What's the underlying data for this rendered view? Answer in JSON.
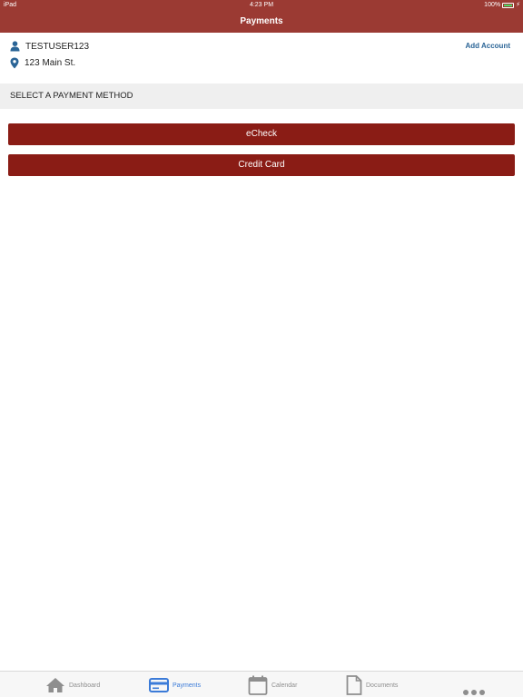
{
  "status_bar": {
    "device": "iPad",
    "time": "4:23 PM",
    "battery": "100%",
    "battery_level": 1.0
  },
  "nav": {
    "title": "Payments"
  },
  "account": {
    "username": "TESTUSER123",
    "address": "123 Main St.",
    "add_account_label": "Add Account",
    "user_icon": "person-icon",
    "address_icon": "location-pin-icon"
  },
  "section": {
    "title": "SELECT A PAYMENT METHOD"
  },
  "payment_methods": [
    {
      "label": "eCheck"
    },
    {
      "label": "Credit Card"
    }
  ],
  "tabs": [
    {
      "label": "Dashboard",
      "icon": "home-icon",
      "active": false
    },
    {
      "label": "Payments",
      "icon": "credit-card-icon",
      "active": true
    },
    {
      "label": "Calendar",
      "icon": "calendar-icon",
      "active": false
    },
    {
      "label": "Documents",
      "icon": "document-icon",
      "active": false
    }
  ],
  "colors": {
    "header_bg": "#9b3a33",
    "button_bg": "#8a1c15",
    "link": "#2a6496",
    "tab_active": "#3b7bd8",
    "tab_inactive": "#8e8e8e"
  }
}
